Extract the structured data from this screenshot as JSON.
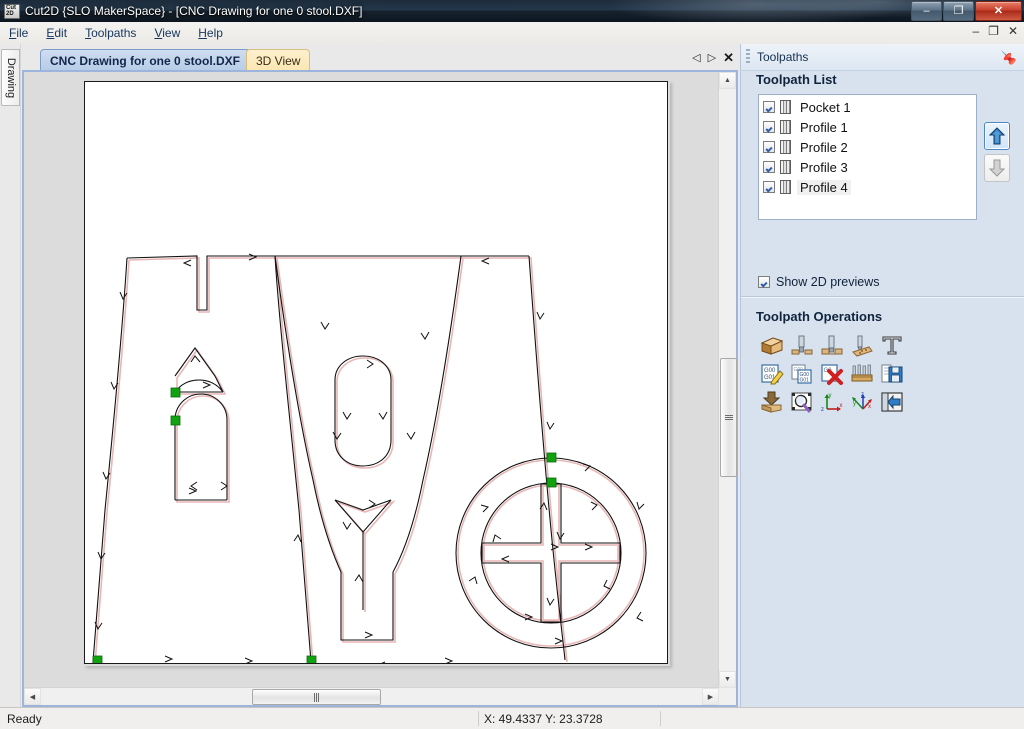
{
  "window": {
    "title": "Cut2D {SLO MakerSpace} - [CNC Drawing for one 0 stool.DXF]",
    "app_icon_label": "Cut 2D",
    "minimize": "–",
    "maximize": "❐",
    "close": "✕"
  },
  "menu": {
    "items": [
      {
        "label": "File",
        "accel": "F"
      },
      {
        "label": "Edit",
        "accel": "E"
      },
      {
        "label": "Toolpaths",
        "accel": "T"
      },
      {
        "label": "View",
        "accel": "V"
      },
      {
        "label": "Help",
        "accel": "H"
      }
    ],
    "window_controls": {
      "restore_down": "–",
      "maximize": "❐",
      "close": "✕"
    }
  },
  "left_dock": {
    "tab_label": "Drawing"
  },
  "document_tabs": {
    "tabs": [
      {
        "label": "CNC Drawing for one 0 stool.DXF",
        "active": true
      },
      {
        "label": "3D View",
        "active": false
      }
    ],
    "nav": {
      "prev": "◁",
      "next": "▷",
      "close": "✕"
    }
  },
  "toolpaths_panel": {
    "header_title": "Toolpaths",
    "pin_icon": "pin-icon",
    "list_title": "Toolpath List",
    "items": [
      {
        "label": "Pocket 1",
        "checked": true,
        "selected": false
      },
      {
        "label": "Profile 1",
        "checked": true,
        "selected": false
      },
      {
        "label": "Profile 2",
        "checked": true,
        "selected": false
      },
      {
        "label": "Profile 3",
        "checked": true,
        "selected": false
      },
      {
        "label": "Profile 4",
        "checked": true,
        "selected": true
      }
    ],
    "move_up_title": "move-up",
    "move_down_title": "move-down",
    "show_2d_previews": {
      "label": "Show 2D previews",
      "checked": true
    },
    "operations_title": "Toolpath Operations",
    "operations": [
      {
        "name": "pocket-toolpath-icon",
        "row": 1
      },
      {
        "name": "profile-toolpath-icon",
        "row": 1
      },
      {
        "name": "drilling-toolpath-icon",
        "row": 1
      },
      {
        "name": "vcarve-toolpath-icon",
        "row": 1
      },
      {
        "name": "text-tool-icon",
        "row": 1
      },
      {
        "name": "edit-gcode-icon",
        "row": 2
      },
      {
        "name": "duplicate-gcode-icon",
        "row": 2
      },
      {
        "name": "delete-gcode-icon",
        "row": 2
      },
      {
        "name": "tool-database-icon",
        "row": 2
      },
      {
        "name": "save-toolpath-icon",
        "row": 2
      },
      {
        "name": "material-setup-icon",
        "row": 3
      },
      {
        "name": "preview-toolpath-icon",
        "row": 3
      },
      {
        "name": "set-2d-view-icon",
        "row": 3
      },
      {
        "name": "set-3d-view-icon",
        "row": 3
      },
      {
        "name": "close-panel-icon",
        "row": 3
      }
    ]
  },
  "status_bar": {
    "ready_text": "Ready",
    "coordinates": "X: 49.4337 Y: 23.3728"
  },
  "colors": {
    "panel_bg": "#d7e2ee",
    "accent_blue": "#9db4dd",
    "active_tab": "#bed2ea",
    "inactive_tab": "#fbe6b0",
    "toolpath_vector": "#e8b6b6",
    "geometry_line": "#000000",
    "node_marker": "#11a211",
    "canvas_paper": "#ffffff",
    "canvas_bg": "#dcdcdc",
    "close_button": "#c9402c"
  }
}
